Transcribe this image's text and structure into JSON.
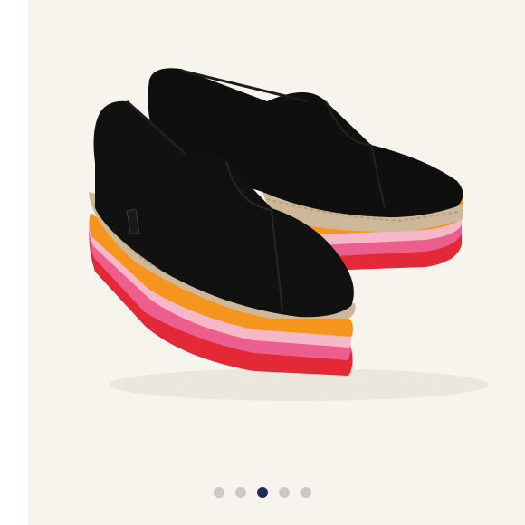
{
  "gallery": {
    "image": {
      "subject": "product-photo",
      "brand_tag_text": "TOMS"
    },
    "pagination": {
      "total": 5,
      "active_index": 2
    },
    "colors": {
      "background": "#f7f4ee",
      "canvas": "#000000",
      "sole_red": "#e32838",
      "sole_pink": "#ec5e8e",
      "sole_light_pink": "#f6b7c7",
      "sole_orange": "#f5951e",
      "jute": "#cdb89a",
      "dot_inactive": "#c9c9c9",
      "dot_active": "#1e2a5a"
    }
  }
}
